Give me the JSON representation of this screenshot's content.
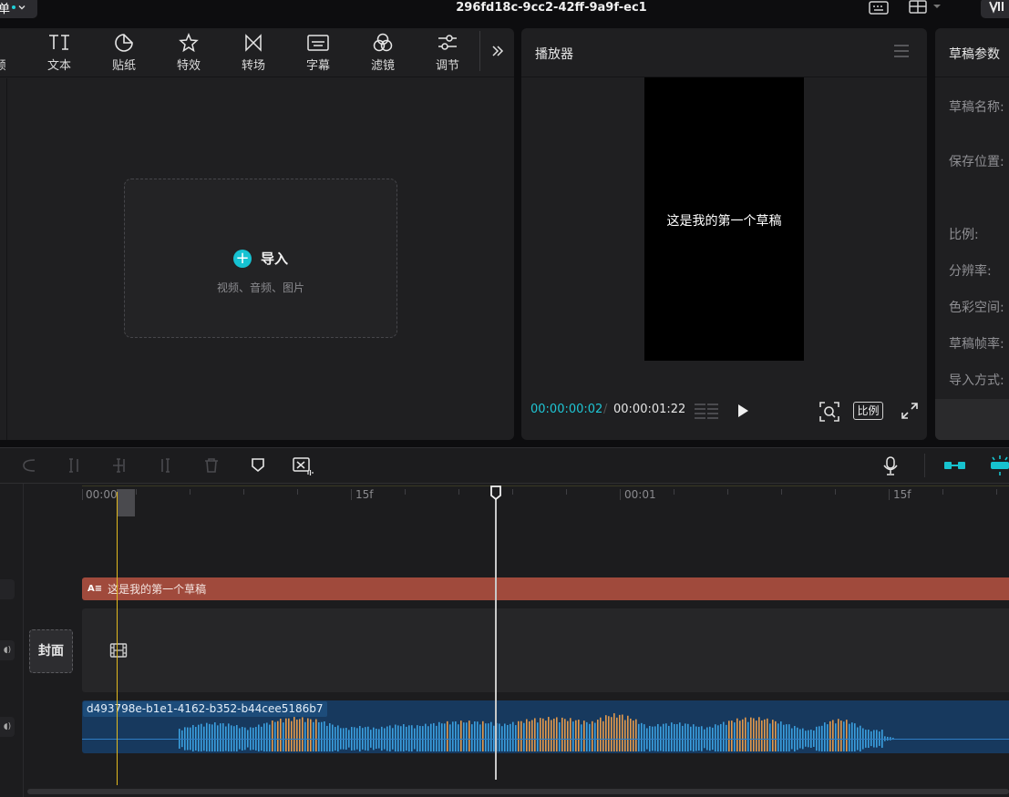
{
  "window": {
    "menu_label": "单",
    "title": "296fd18c-9cc2-42ff-9a9f-ec1"
  },
  "media_toolbar": {
    "tools": [
      {
        "label": "频",
        "icon": "audio-icon"
      },
      {
        "label": "文本",
        "icon": "text-icon"
      },
      {
        "label": "贴纸",
        "icon": "sticker-icon"
      },
      {
        "label": "特效",
        "icon": "effects-icon"
      },
      {
        "label": "转场",
        "icon": "transition-icon"
      },
      {
        "label": "字幕",
        "icon": "subtitle-icon"
      },
      {
        "label": "滤镜",
        "icon": "filter-icon"
      },
      {
        "label": "调节",
        "icon": "adjust-icon"
      }
    ],
    "more_icon": "double-chevron-right-icon"
  },
  "import": {
    "label": "导入",
    "subtitle": "视频、音频、图片",
    "icon": "plus-circle-icon"
  },
  "player": {
    "title": "播放器",
    "menu_icon": "hamburger-menu-icon",
    "caption": "这是我的第一个草稿",
    "time_current": "00:00:00:02",
    "time_separator": "/",
    "time_total": "00:00:01:22",
    "ratio_label": "比例"
  },
  "params": {
    "title": "草稿参数",
    "fields": [
      "草稿名称:",
      "保存位置:",
      "比例:",
      "分辨率:",
      "色彩空间:",
      "草稿帧率:",
      "导入方式:"
    ]
  },
  "timeline": {
    "ruler_labels": [
      "00:00",
      "15f",
      "00:01",
      "15f"
    ],
    "text_clip_icon": "A≡",
    "text_clip_label": "这是我的第一个草稿",
    "cover_label": "封面",
    "audio_clip_name": "d493798e-b1e1-4162-b352-b44cee5186b7",
    "playhead_position_fraction": 0.47
  },
  "colors": {
    "accent": "#16c2d2",
    "text_clip": "#a04a3c",
    "audio_clip": "#17395e",
    "waveform": "#3aa0e0",
    "playhead_marker": "#e2b91f"
  }
}
